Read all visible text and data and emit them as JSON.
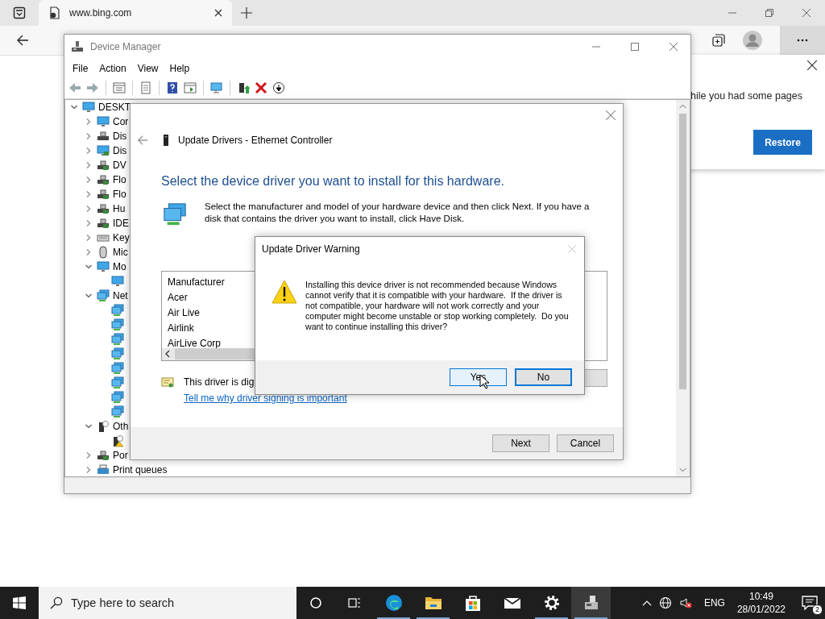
{
  "browser": {
    "tab": {
      "title": "www.bing.com"
    },
    "restore_banner": {
      "text": "hile you had some pages",
      "button": "Restore"
    }
  },
  "device_manager": {
    "title": "Device Manager",
    "menu": [
      "File",
      "Action",
      "View",
      "Help"
    ],
    "tree": [
      {
        "label": "DESKT",
        "kind": "computer",
        "expanded": true,
        "children": [
          {
            "label": "Cor",
            "kind": "computer",
            "expanded": false
          },
          {
            "label": "Dis",
            "kind": "disk",
            "expanded": false
          },
          {
            "label": "Dis",
            "kind": "display",
            "expanded": false
          },
          {
            "label": "DV",
            "kind": "dvd",
            "expanded": false
          },
          {
            "label": "Flo",
            "kind": "floppy",
            "expanded": false
          },
          {
            "label": "Flo",
            "kind": "floppy",
            "expanded": false
          },
          {
            "label": "Hu",
            "kind": "hid",
            "expanded": false
          },
          {
            "label": "IDE",
            "kind": "ide",
            "expanded": false
          },
          {
            "label": "Key",
            "kind": "keyboard",
            "expanded": false
          },
          {
            "label": "Mic",
            "kind": "mouse",
            "expanded": false
          },
          {
            "label": "Mo",
            "kind": "monitor",
            "expanded": true,
            "children": [
              {
                "kind": "monitor"
              }
            ]
          },
          {
            "label": "Net",
            "kind": "network",
            "expanded": true,
            "children": [
              {
                "kind": "network"
              },
              {
                "kind": "network"
              },
              {
                "kind": "network"
              },
              {
                "kind": "network"
              },
              {
                "kind": "network"
              },
              {
                "kind": "network"
              },
              {
                "kind": "network"
              },
              {
                "kind": "network"
              }
            ]
          },
          {
            "label": "Oth",
            "kind": "other",
            "expanded": true,
            "children": [
              {
                "kind": "warning"
              }
            ]
          },
          {
            "label": "Por",
            "kind": "port",
            "expanded": false
          },
          {
            "label": "Print queues",
            "kind": "printer",
            "expanded": false
          }
        ]
      }
    ]
  },
  "update_dialog": {
    "title": "Update Drivers - Ethernet Controller",
    "heading": "Select the device driver you want to install for this hardware.",
    "description": "Select the manufacturer and model of your hardware device and then click Next. If you have a disk that contains the driver you want to install, click Have Disk.",
    "list_header": "Manufacturer",
    "manufacturers": [
      "Acer",
      "Air Live",
      "Airlink",
      "AirLive Corp"
    ],
    "signing_text": "This driver is digi",
    "signing_link": "Tell me why driver signing is important",
    "buttons": [
      "Next",
      "Cancel"
    ]
  },
  "warning_dialog": {
    "title": "Update Driver Warning",
    "message": "Installing this device driver is not recommended because Windows cannot verify that it is compatible with your hardware.  If the driver is not compatible, your hardware will not work correctly and your computer might become unstable or stop working completely.  Do you want to continue installing this driver?",
    "buttons": [
      {
        "label": "Yes",
        "selected": false
      },
      {
        "label": "No",
        "selected": true
      }
    ]
  },
  "taskbar": {
    "search_placeholder": "Type here to search",
    "apps": [
      {
        "kind": "edge",
        "running": true,
        "selected": false
      },
      {
        "kind": "explorer",
        "running": true,
        "selected": false
      },
      {
        "kind": "store",
        "running": false,
        "selected": false
      },
      {
        "kind": "mail",
        "running": false,
        "selected": false
      },
      {
        "kind": "settings",
        "running": true,
        "selected": false
      },
      {
        "kind": "device-manager",
        "running": true,
        "selected": true
      }
    ],
    "language": "ENG",
    "time": "10:49",
    "date": "28/01/2022",
    "notification_count": "2"
  }
}
